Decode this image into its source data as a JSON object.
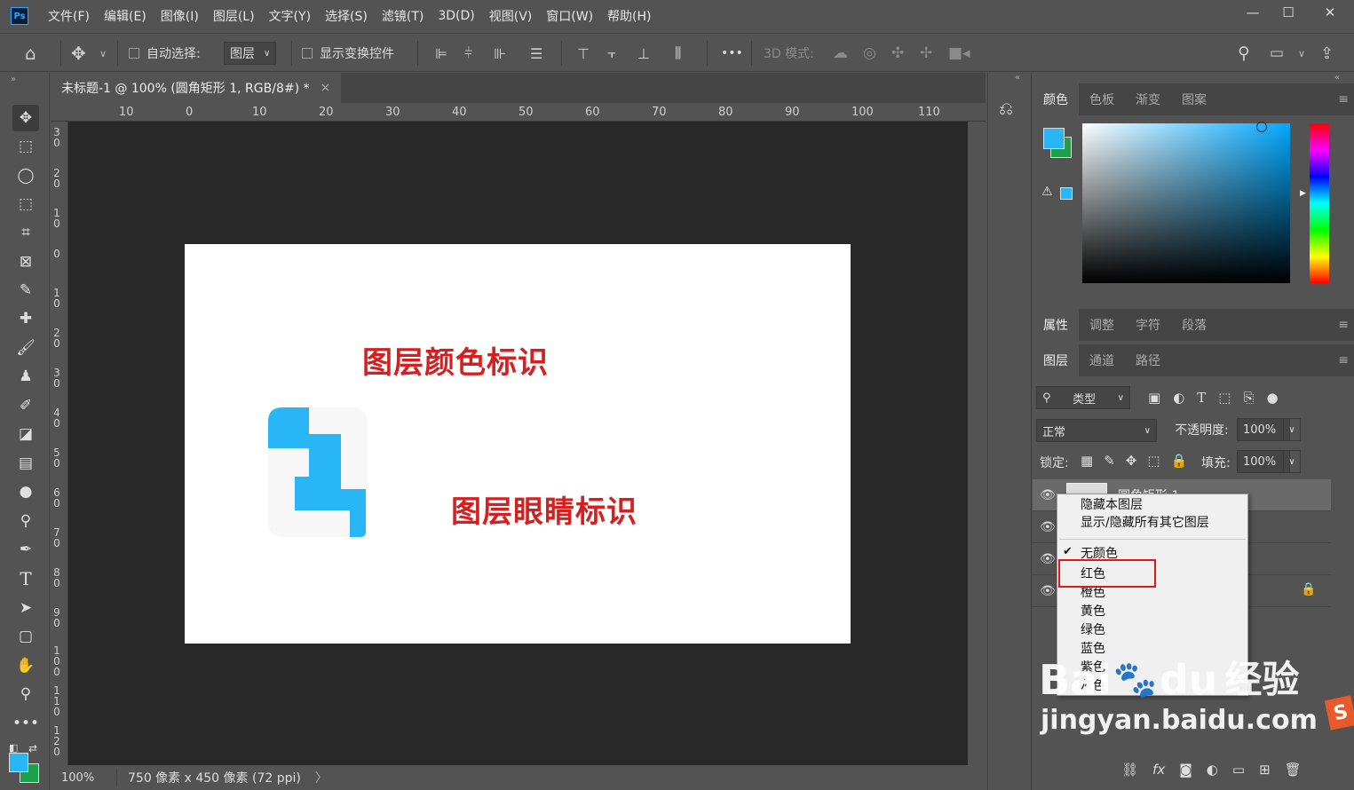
{
  "app": {
    "logo": "Ps"
  },
  "menu": [
    "文件(F)",
    "编辑(E)",
    "图像(I)",
    "图层(L)",
    "文字(Y)",
    "选择(S)",
    "滤镜(T)",
    "3D(D)",
    "视图(V)",
    "窗口(W)",
    "帮助(H)"
  ],
  "window_controls": {
    "minimize": "—",
    "maximize": "☐",
    "close": "✕"
  },
  "options": {
    "auto_select_label": "自动选择:",
    "auto_select_value": "图层",
    "show_transform_label": "显示变换控件",
    "mode_3d_label": "3D 模式:",
    "more": "•••"
  },
  "document": {
    "tab_title": "未标题-1 @ 100% (圆角矩形 1, RGB/8#) *",
    "tab_close": "×",
    "text_1": "图层颜色标识",
    "text_2": "图层眼睛标识",
    "shape_color": "#29b6f6"
  },
  "rulers": {
    "top": [
      "10",
      "0",
      "10",
      "20",
      "30",
      "40",
      "50",
      "60",
      "70",
      "80",
      "90",
      "100",
      "110"
    ],
    "left": [
      "3 0",
      "2 0",
      "1 0",
      "0",
      "1 0",
      "2 0",
      "3 0",
      "4 0",
      "5 0",
      "6 0",
      "7 0",
      "8 0",
      "9 0",
      "1 0 0",
      "1 1 0",
      "1 2 0"
    ]
  },
  "status": {
    "zoom": "100%",
    "info": "750 像素 x 450 像素 (72 ppi)",
    "arrow": "〉"
  },
  "colors": {
    "foreground": "#29b6f6",
    "background": "#1aa14a",
    "accent": "#31a8ff"
  },
  "panels": {
    "color_tabs": [
      "颜色",
      "色板",
      "渐变",
      "图案"
    ],
    "props_tabs": [
      "属性",
      "调整",
      "字符",
      "段落"
    ],
    "layers_tabs": [
      "图层",
      "通道",
      "路径"
    ],
    "filter_kind": "类型",
    "blend_mode": "正常",
    "opacity_label": "不透明度:",
    "opacity_value": "100%",
    "lock_label": "锁定:",
    "fill_label": "填充:",
    "fill_value": "100%",
    "layer_name_partial": "圆角矩形 1"
  },
  "context_menu": {
    "items": [
      "隐藏本图层",
      "显示/隐藏所有其它图层",
      "无颜色",
      "红色",
      "橙色",
      "黄色",
      "绿色",
      "蓝色",
      "紫色",
      "灰色"
    ],
    "checked": "无颜色",
    "highlighted": "红色"
  },
  "watermark": {
    "brand": "Bai",
    "brand2": "du",
    "cn": "经验",
    "url": "jingyan.baidu.com"
  }
}
